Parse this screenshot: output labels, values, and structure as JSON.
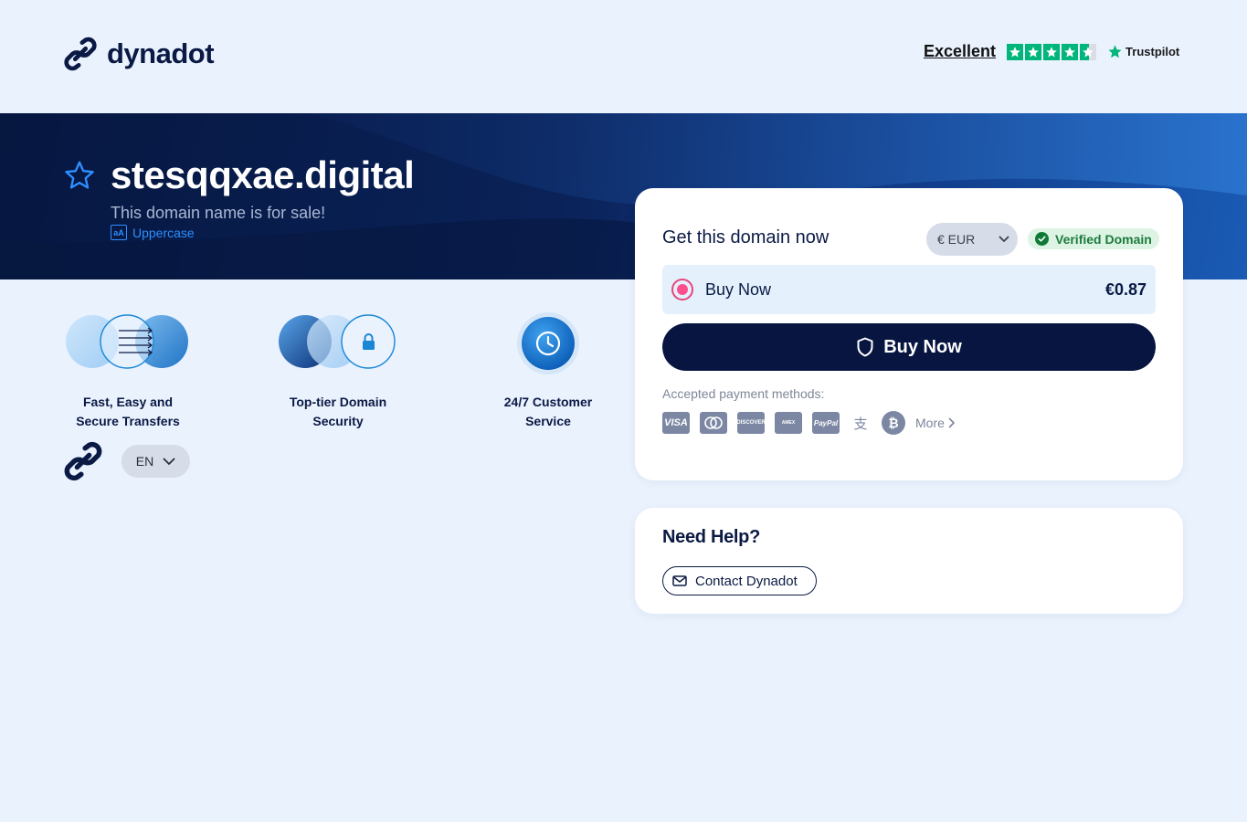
{
  "brand": {
    "name": "dynadot"
  },
  "trustpilot": {
    "rating_label": "Excellent",
    "name": "Trustpilot",
    "stars": 4.5
  },
  "domain": {
    "name": "stesqqxae.digital",
    "subtitle": "This domain name is for sale!",
    "uppercase_label": "Uppercase",
    "uppercase_icon_text": "aA"
  },
  "features": [
    {
      "label_line1": "Fast, Easy and",
      "label_line2": "Secure Transfers"
    },
    {
      "label_line1": "Top-tier Domain",
      "label_line2": "Security"
    },
    {
      "label_line1": "24/7 Customer",
      "label_line2": "Service"
    }
  ],
  "language": {
    "selected": "EN"
  },
  "purchase": {
    "title": "Get this domain now",
    "currency": "€ EUR",
    "verified_label": "Verified Domain",
    "option_label": "Buy Now",
    "option_price": "€0.87",
    "buy_button_label": "Buy Now",
    "payment_label": "Accepted payment methods:",
    "payment_methods": [
      "VISA",
      "Mastercard",
      "DISCOVER",
      "AMEX",
      "PayPal",
      "Alipay",
      "Bitcoin"
    ],
    "more_label": "More"
  },
  "help": {
    "title": "Need Help?",
    "contact_label": "Contact Dynadot"
  },
  "colors": {
    "page_bg": "#eaf2fe",
    "banner_dark": "#061740",
    "accent_blue": "#2d8fff",
    "button_dark": "#071540",
    "verified_green": "#1c7b3c",
    "radio_pink": "#ff4e8d",
    "trustpilot_green": "#00b67a"
  }
}
